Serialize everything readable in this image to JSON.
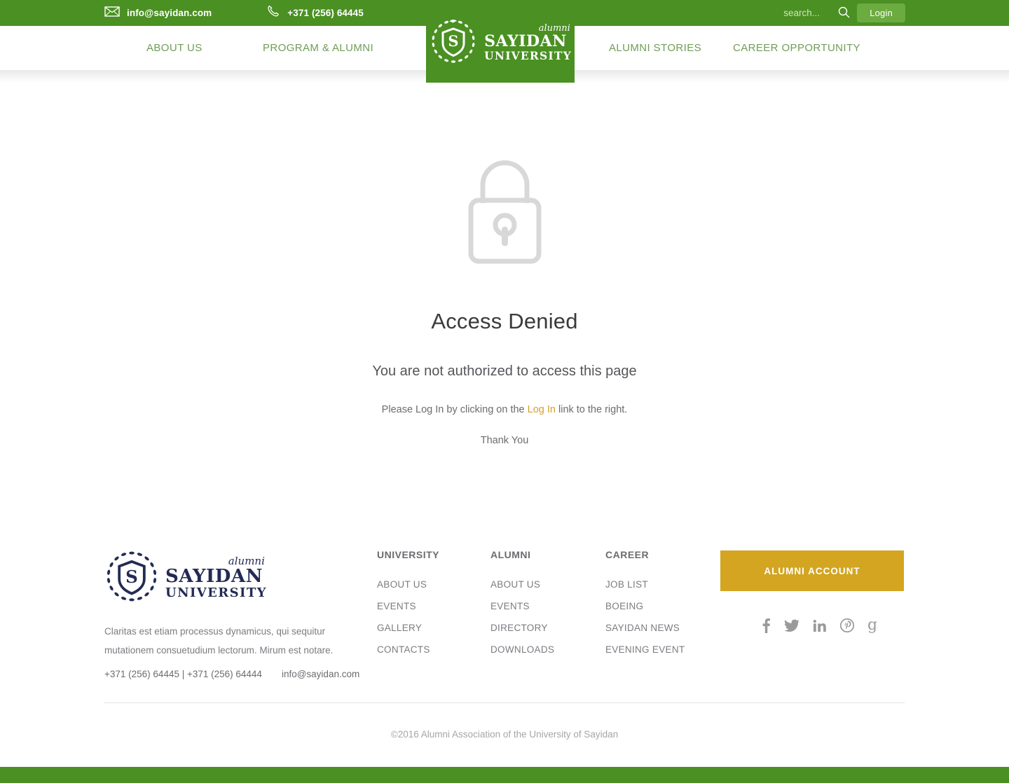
{
  "topbar": {
    "email": "info@sayidan.com",
    "phone": "+371 (256) 64445",
    "mail_icon": "mail-icon",
    "phone_icon": "phone-icon",
    "search_placeholder": "search...",
    "search_value": "",
    "search_icon": "search-icon",
    "login_label": "Login"
  },
  "logo": {
    "alumni": "alumni",
    "line1": "SAYIDAN",
    "line2": "UNIVERSITY",
    "emblem_icon": "shield-wreath-icon",
    "shield_letter": "S",
    "header_bg": "#4a9022",
    "footer_color": "#232b54"
  },
  "nav": {
    "items": [
      {
        "label": "ABOUT US"
      },
      {
        "label": "PROGRAM & ALUMNI"
      },
      {
        "label": "ALUMNI STORIES"
      },
      {
        "label": "CAREER OPPORTUNITY"
      }
    ]
  },
  "main": {
    "lock_icon": "padlock-icon",
    "title": "Access Denied",
    "subtitle": "You are not authorized to access this page",
    "note_before": "Please Log In by clicking on the ",
    "note_link": "Log In",
    "note_after": " link to the right.",
    "thanks": "Thank You",
    "link_color": "#d1a22c"
  },
  "footer": {
    "description": "Claritas est etiam processus dynamicus, qui sequitur mutationem consuetudium lectorum. Mirum est notare.",
    "phones": "+371 (256) 64445 | +371 (256) 64444",
    "email": "info@sayidan.com",
    "columns": [
      {
        "title": "UNIVERSITY",
        "links": [
          "ABOUT US",
          "EVENTS",
          "GALLERY",
          "CONTACTS"
        ]
      },
      {
        "title": "ALUMNI",
        "links": [
          "ABOUT US",
          "EVENTS",
          "DIRECTORY",
          "DOWNLOADS"
        ]
      },
      {
        "title": "CAREER",
        "links": [
          "JOB LIST",
          "BOEING",
          "SAYIDAN NEWS",
          "EVENING EVENT"
        ]
      }
    ],
    "account_button": "ALUMNI ACCOUNT",
    "account_button_color": "#d3a521",
    "socials": [
      {
        "name": "facebook-icon",
        "glyph": "f"
      },
      {
        "name": "twitter-icon",
        "glyph": ""
      },
      {
        "name": "linkedin-icon",
        "glyph": "in"
      },
      {
        "name": "pinterest-icon",
        "glyph": ""
      },
      {
        "name": "google-plus-icon",
        "glyph": "g"
      }
    ],
    "copyright": "©2016 Alumni Association of the University of Sayidan"
  }
}
